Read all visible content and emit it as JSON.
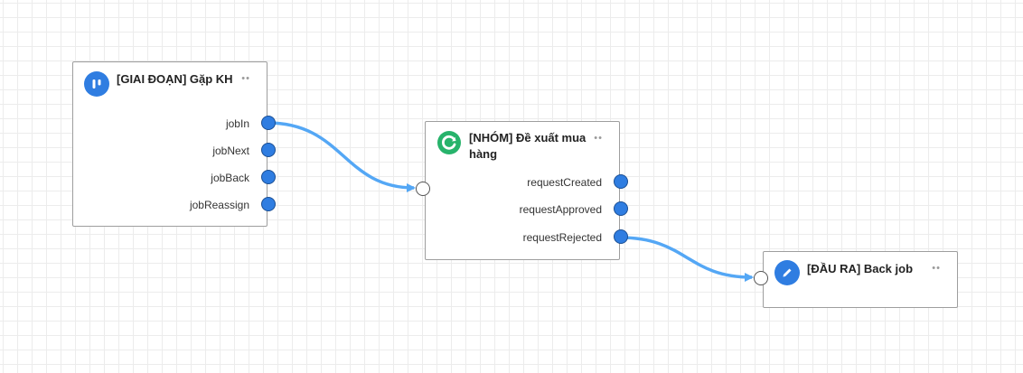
{
  "nodes": {
    "stage": {
      "title": "[GIAI ĐOẠN] Gặp KH",
      "menu": "••",
      "icon": "kanban-icon",
      "icon_color": "#2f7de1",
      "outputs": [
        "jobIn",
        "jobNext",
        "jobBack",
        "jobReassign"
      ]
    },
    "group": {
      "title_line1": "[NHÓM] Đề xuất mua",
      "title_line2": "hàng",
      "menu": "••",
      "icon": "refresh-icon",
      "icon_color": "#27b36b",
      "outputs": [
        "requestCreated",
        "requestApproved",
        "requestRejected"
      ]
    },
    "output": {
      "title": "[ĐẦU RA] Back job",
      "menu": "••",
      "icon": "pencil-icon",
      "icon_color": "#2f7de1"
    }
  },
  "edge_color": "#54a7f5",
  "port_color": "#2f7de1"
}
